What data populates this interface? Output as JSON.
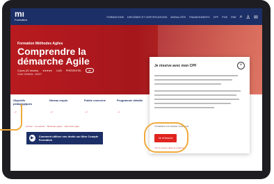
{
  "brand": {
    "logo": "mı",
    "tagline": "Formation"
  },
  "nav": {
    "items": [
      "FORMATIONS",
      "DIPLÔMES ET CERTIFICATIONS",
      "MODALITÉS",
      "FINANCEMENTS",
      "CPF",
      "POE",
      "FNE"
    ],
    "icons": [
      "search-icon",
      "user-icon",
      "mail-icon"
    ]
  },
  "hero": {
    "kicker": "Formation Méthodes Agiles",
    "title": "Comprendre la démarche Agile",
    "duration": "3 jours (21 heures)",
    "rating_stars": "★★★★★",
    "rating_value": "4.6/5",
    "format": "PRÉSENTIEL",
    "code": "Code CertifInfo : 84437"
  },
  "tabs": [
    {
      "label": "Objectifs pédagogiques"
    },
    {
      "label": "Niveau requis"
    },
    {
      "label": "Public concerné"
    },
    {
      "label": "Programme détaillé"
    }
  ],
  "breadcrumb": [
    "Accueil",
    "Formations",
    "Méthodes Agiles",
    "Démarche Agile"
  ],
  "video": {
    "label": "Comment utiliser vos droits sur Mon Compte Formation"
  },
  "modal": {
    "title": "Je réserve avec mon CPF",
    "sub": "Choisissez une session ci-dessous",
    "cta": "Je m'inscris",
    "link": "Voir les autres dates et sessions ▸",
    "close": "×"
  },
  "colors": {
    "accent": "#e0241f",
    "navy": "#1c2f66",
    "highlight": "#f0a93a"
  }
}
